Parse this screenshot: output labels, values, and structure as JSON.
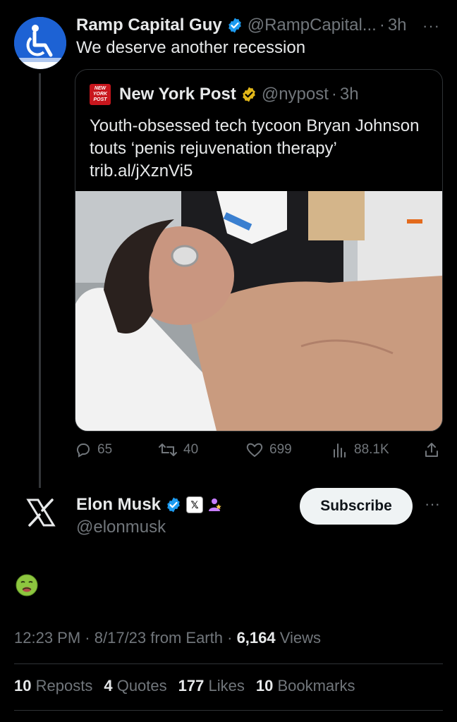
{
  "parent_tweet": {
    "author_name": "Ramp Capital Guy",
    "author_handle": "@RampCapital...",
    "time": "3h",
    "dot": "·",
    "more": "···",
    "text": "We deserve another recession",
    "avatar_icon": "wheelchair-accessibility-icon"
  },
  "quote": {
    "logo_lines": [
      "NEW",
      "YORK",
      "POST"
    ],
    "author_name": "New York Post",
    "author_handle": "@nypost",
    "time": "3h",
    "dot": "·",
    "text": "Youth-obsessed tech tycoon Bryan Johnson touts ‘penis rejuvenation therapy’ trib.al/jXznVi5",
    "image_alt": "photo-man-laser-treatment"
  },
  "actions": {
    "replies": "65",
    "reposts": "40",
    "likes": "699",
    "views": "88.1K"
  },
  "reply_tweet": {
    "author_name": "Elon Musk",
    "author_handle": "@elonmusk",
    "badge_x": "𝕏",
    "subscribe_label": "Subscribe",
    "more": "···",
    "emoji": "nauseated-face"
  },
  "meta": {
    "time": "12:23 PM",
    "sep1": "·",
    "date": "8/17/23",
    "source": "from Earth",
    "sep2": "·",
    "views_count": "6,164",
    "views_label": "Views"
  },
  "stats": {
    "reposts_count": "10",
    "reposts_label": "Reposts",
    "quotes_count": "4",
    "quotes_label": "Quotes",
    "likes_count": "177",
    "likes_label": "Likes",
    "bookmarks_count": "10",
    "bookmarks_label": "Bookmarks"
  },
  "colors": {
    "background": "#000000",
    "text": "#e7e9ea",
    "muted": "#71767b",
    "verified_blue": "#1d9bf0",
    "verified_gold": "#e2b719",
    "nypost_red": "#c8161d"
  }
}
